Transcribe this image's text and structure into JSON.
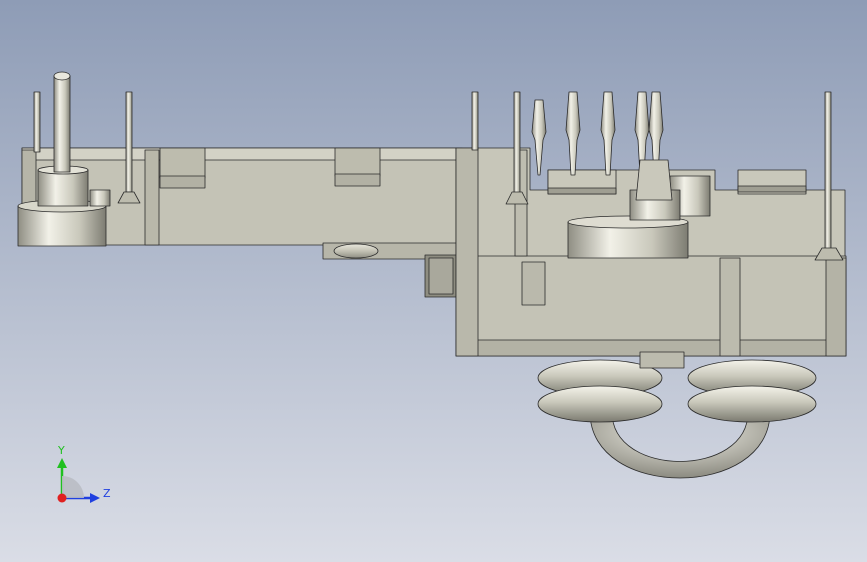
{
  "viewport": {
    "background_top": "#8e9cb6",
    "background_bottom": "#dadde6"
  },
  "colors": {
    "metal_light": "#e8e7dc",
    "metal_mid": "#c9c8bb",
    "metal_dark": "#8f8e83",
    "edge": "#2b2b2b",
    "housing": "#c4c3b6",
    "housing_shadow": "#a9a89c"
  },
  "triad": {
    "y_label": "Y",
    "z_label": "Z",
    "y_color": "#20c020",
    "z_color": "#2040e0",
    "x_color": "#e02020"
  }
}
